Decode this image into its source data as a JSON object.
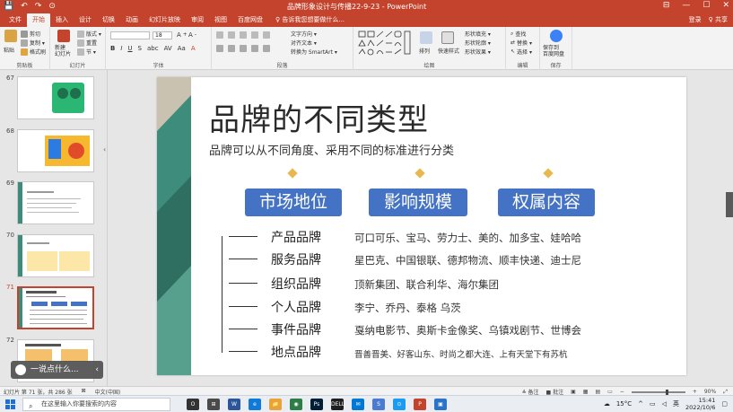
{
  "titlebar": {
    "doc_title": "品牌形象设计与传播22-9-23 - PowerPoint",
    "quick_access": [
      "💾",
      "↶",
      "↷",
      "⊙"
    ],
    "controls": [
      "⊟",
      "—",
      "☐",
      "✕"
    ]
  },
  "menubar": {
    "tabs": [
      "文件",
      "开始",
      "插入",
      "设计",
      "切换",
      "动画",
      "幻灯片放映",
      "审阅",
      "视图",
      "百度网盘"
    ],
    "active_tab": "开始",
    "tell_me": "♀ 告诉我您想要做什么...",
    "login": "登录",
    "share": "♀ 共享"
  },
  "ribbon": {
    "groups": {
      "clipboard": "剪贴板",
      "slides": "幻灯片",
      "font": "字体",
      "paragraph": "段落",
      "drawing": "绘图",
      "editing": "编辑",
      "save": "保存"
    },
    "paste": "粘贴",
    "cut": "剪切",
    "copy": "复制 ▾",
    "format_painter": "格式刷",
    "new_slide": "新建\n幻灯片",
    "layout": "版式 ▾",
    "reset": "重置",
    "section": "节 ▾",
    "font_name": "",
    "font_size": "18",
    "text_direction": "文字方向 ▾",
    "align_text": "对齐文本 ▾",
    "smartart": "转换为 SmartArt ▾",
    "arrange": "排列",
    "quick_styles": "快速样式",
    "shape_fill": "形状填充 ▾",
    "shape_outline": "形状轮廓 ▾",
    "shape_effects": "形状效果 ▾",
    "find": "查找",
    "replace": "替换 ▾",
    "select": "选择 ▾",
    "save_baidu": "保存到\n百度网盘"
  },
  "thumbnails": [
    {
      "num": "67",
      "selected": false
    },
    {
      "num": "68",
      "selected": false
    },
    {
      "num": "69",
      "selected": false
    },
    {
      "num": "70",
      "selected": false
    },
    {
      "num": "71",
      "selected": true
    },
    {
      "num": "72",
      "selected": false
    }
  ],
  "slide": {
    "title": "品牌的不同类型",
    "subtitle": "品牌可以从不同角度、采用不同的标准进行分类",
    "categories": [
      "市场地位",
      "影响规模",
      "权属内容"
    ],
    "rows": [
      {
        "name": "产品品牌",
        "examples": "可口可乐、宝马、劳力士、美的、加多宝、娃哈哈"
      },
      {
        "name": "服务品牌",
        "examples": "星巴克、中国银联、德邦物流、顺丰快递、迪士尼"
      },
      {
        "name": "组织品牌",
        "examples": "顶新集团、联合利华、海尔集团"
      },
      {
        "name": "个人品牌",
        "examples": "李宁、乔丹、泰格 乌茨"
      },
      {
        "name": "事件品牌",
        "examples": "戛纳电影节、奥斯卡金像奖、乌镇戏剧节、世博会"
      },
      {
        "name": "地点品牌",
        "examples": "晋善晋美、好客山东、时尚之都大连、上有天堂下有苏杭"
      }
    ]
  },
  "statusbar": {
    "slide_info": "幻灯片 第 71 张，共 286 张",
    "language": "中文(中国)",
    "notes": "≜ 备注",
    "comments": "■ 批注",
    "zoom": "90%"
  },
  "assistant": {
    "text": "一说点什么..."
  },
  "taskbar": {
    "search_placeholder": "在这里输入你要搜索的内容",
    "weather": "15°C",
    "ime": "英",
    "time": "15:41",
    "date": "2022/10/6",
    "apps": [
      "O",
      "⊞",
      "W",
      "e",
      "📁",
      "◉",
      "Ps",
      "DELL",
      "✉",
      "S",
      "⊙",
      "P",
      "▣"
    ],
    "app_colors": [
      "#333333",
      "#4a4a4a",
      "#2b579a",
      "#0f7ad8",
      "#e8a33a",
      "#2d7d46",
      "#001e36",
      "#1f1f1f",
      "#0078d4",
      "#4a7bd0",
      "#1d9bf0",
      "#c4432c",
      "#2b73c8"
    ]
  },
  "colors": {
    "accent": "#c4432c",
    "category_blue": "#4472c4",
    "diamond_gold": "#e8b84f"
  }
}
